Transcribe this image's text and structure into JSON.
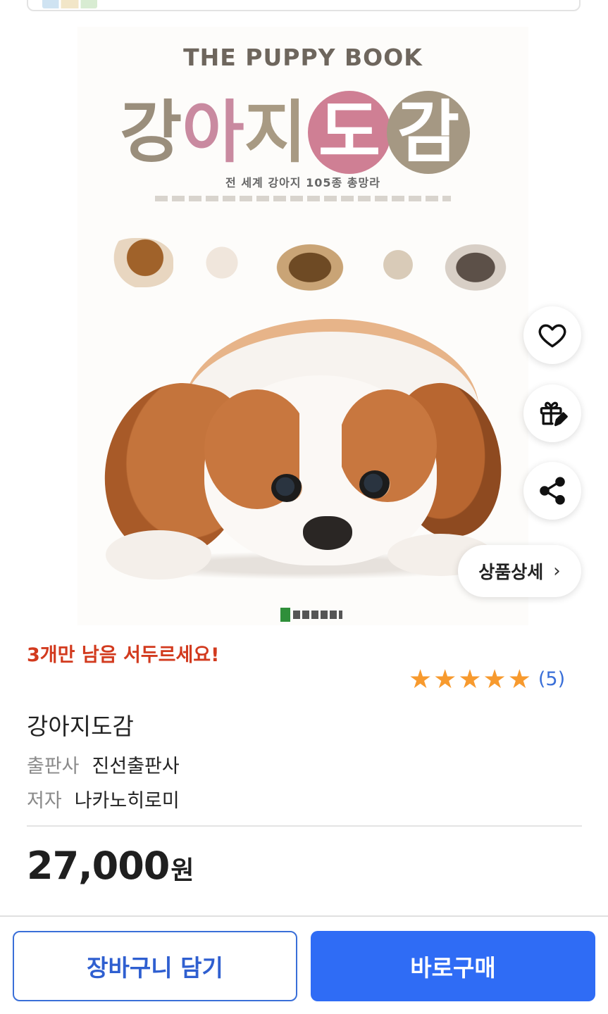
{
  "cover": {
    "english_title": "THE PUPPY BOOK",
    "korean_title_chars": [
      "강",
      "아",
      "지",
      "도",
      "감"
    ],
    "subtitle": "전 세계 강아지 105종 총망라"
  },
  "actions": {
    "wishlist_icon": "heart-icon",
    "gift_icon": "gift-icon",
    "share_icon": "share-icon",
    "detail_button": "상품상세",
    "detail_chevron": "›"
  },
  "product": {
    "stock_alert": "3개만 남음 서두르세요!",
    "rating_stars": 5,
    "review_count": "(5)",
    "title": "강아지도감",
    "publisher_label": "출판사",
    "publisher": "진선출판사",
    "author_label": "저자",
    "author": "나카노히로미",
    "price": "27,000",
    "price_unit": "원"
  },
  "bottom_bar": {
    "cart_button": "장바구니 담기",
    "buy_button": "바로구매"
  },
  "colors": {
    "accent_blue": "#2f6cf5",
    "alert_red": "#d23a1e",
    "star_orange": "#f79a2e",
    "review_link": "#3a6fd8"
  }
}
